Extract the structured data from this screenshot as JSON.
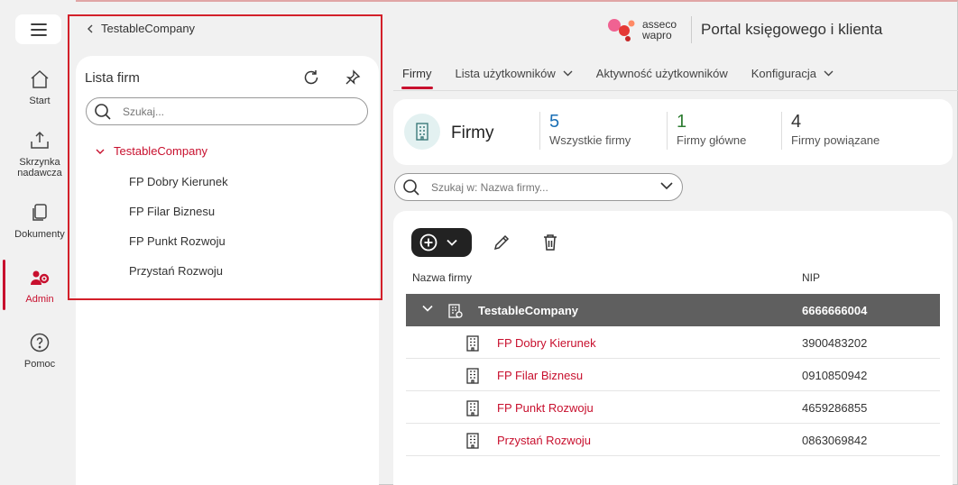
{
  "rail": {
    "items": [
      {
        "label": "Start",
        "icon": "home-icon"
      },
      {
        "label": "Skrzynka nadawcza",
        "icon": "outbox-icon"
      },
      {
        "label": "Dokumenty",
        "icon": "documents-icon"
      },
      {
        "label": "Admin",
        "icon": "admin-icon",
        "active": true
      },
      {
        "label": "Pomoc",
        "icon": "help-icon"
      }
    ]
  },
  "panel": {
    "breadcrumb": "TestableCompany",
    "title": "Lista firm",
    "search_placeholder": "Szukaj...",
    "root": "TestableCompany",
    "children": [
      "FP Dobry Kierunek",
      "FP Filar Biznesu",
      "FP Punkt Rozwoju",
      "Przystań Rozwoju"
    ]
  },
  "brand": {
    "logo_line1": "asseco",
    "logo_line2": "wapro",
    "title": "Portal księgowego i klienta"
  },
  "tabs": [
    {
      "label": "Firmy",
      "active": true
    },
    {
      "label": "Lista użytkowników",
      "dropdown": true
    },
    {
      "label": "Aktywność użytkowników"
    },
    {
      "label": "Konfiguracja",
      "dropdown": true
    }
  ],
  "summary": {
    "title": "Firmy",
    "stats": [
      {
        "value": "5",
        "label": "Wszystkie firmy",
        "color": "#1a6fb5"
      },
      {
        "value": "1",
        "label": "Firmy główne",
        "color": "#2e7d32"
      },
      {
        "value": "4",
        "label": "Firmy powiązane",
        "color": "#333333"
      }
    ]
  },
  "filter": {
    "placeholder": "Szukaj w: Nazwa firmy..."
  },
  "table": {
    "headers": {
      "name": "Nazwa firmy",
      "nip": "NIP"
    },
    "rows": [
      {
        "name": "TestableCompany",
        "nip": "6666666004",
        "selected": true
      },
      {
        "name": "FP Dobry Kierunek",
        "nip": "3900483202"
      },
      {
        "name": "FP Filar Biznesu",
        "nip": "0910850942"
      },
      {
        "name": "FP Punkt Rozwoju",
        "nip": "4659286855"
      },
      {
        "name": "Przystań Rozwoju",
        "nip": "0863069842"
      }
    ]
  },
  "colors": {
    "accent": "#c8102e",
    "selected_row": "#5f5f5f"
  }
}
